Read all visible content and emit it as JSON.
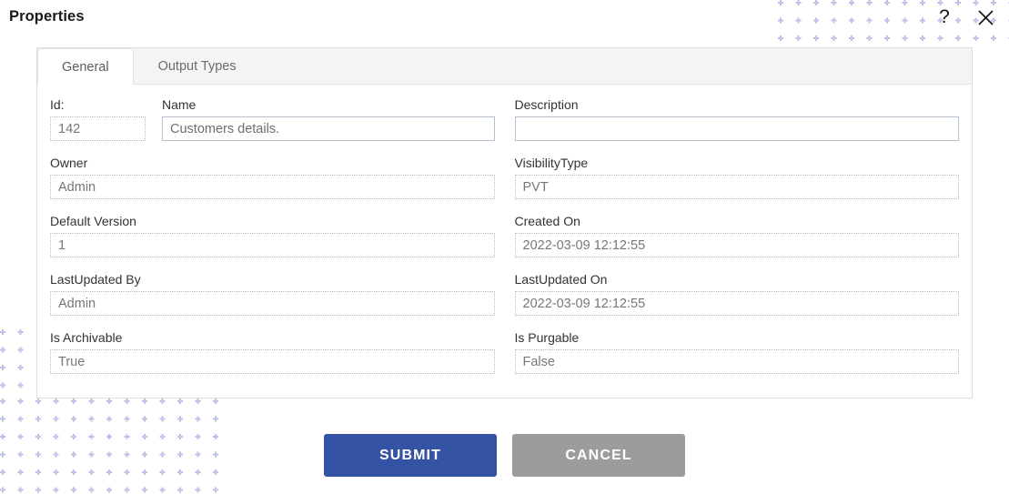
{
  "header": {
    "title": "Properties",
    "help_icon": "question-mark-icon",
    "help_label": "?",
    "close_icon": "close-icon"
  },
  "tabs": [
    {
      "label": "General",
      "active": true
    },
    {
      "label": "Output Types",
      "active": false
    }
  ],
  "form": {
    "id": {
      "label": "Id:",
      "value": "142",
      "readonly": true
    },
    "name": {
      "label": "Name",
      "value": "Customers details.",
      "readonly": false
    },
    "description": {
      "label": "Description",
      "value": "",
      "readonly": false
    },
    "owner": {
      "label": "Owner",
      "value": "Admin",
      "readonly": true
    },
    "visibility_type": {
      "label": "VisibilityType",
      "value": "PVT",
      "readonly": true
    },
    "default_version": {
      "label": "Default Version",
      "value": "1",
      "readonly": true
    },
    "created_on": {
      "label": "Created On",
      "value": "2022-03-09 12:12:55",
      "readonly": true
    },
    "lastupdated_by": {
      "label": "LastUpdated By",
      "value": "Admin",
      "readonly": true
    },
    "lastupdated_on": {
      "label": "LastUpdated On",
      "value": "2022-03-09 12:12:55",
      "readonly": true
    },
    "is_archivable": {
      "label": "Is Archivable",
      "value": "True",
      "readonly": true
    },
    "is_purgable": {
      "label": "Is Purgable",
      "value": "False",
      "readonly": true
    }
  },
  "actions": {
    "submit_label": "SUBMIT",
    "cancel_label": "CANCEL"
  },
  "colors": {
    "submit_background": "#3553a5",
    "cancel_background": "#9c9c9c",
    "pattern_dot": "#b9c0e8",
    "tabbar_background": "#f4f4f4",
    "panel_border": "#dedede"
  }
}
